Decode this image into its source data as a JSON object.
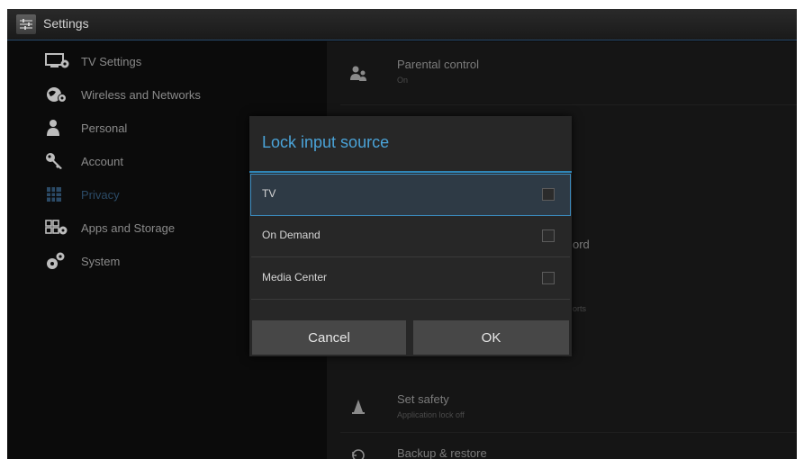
{
  "window": {
    "title": "Settings"
  },
  "sidebar": {
    "items": [
      {
        "label": "TV Settings",
        "icon": "tv-settings-icon",
        "active": false
      },
      {
        "label": "Wireless and Networks",
        "icon": "globe-network-icon",
        "active": false
      },
      {
        "label": "Personal",
        "icon": "person-icon",
        "active": false
      },
      {
        "label": "Account",
        "icon": "key-icon",
        "active": false
      },
      {
        "label": "Privacy",
        "icon": "privacy-grid-icon",
        "active": true
      },
      {
        "label": "Apps and Storage",
        "icon": "apps-storage-icon",
        "active": false
      },
      {
        "label": "System",
        "icon": "gears-icon",
        "active": false
      }
    ]
  },
  "right_panel": {
    "parental_control": {
      "title": "Parental control",
      "subtitle": "On",
      "icon": "parental-control-icon"
    },
    "partial_password_text": "ord",
    "partial_ports_text": "orts",
    "set_safety": {
      "title": "Set safety",
      "subtitle": "Application lock off",
      "icon": "cone-icon"
    },
    "backup_restore": {
      "title": "Backup & restore",
      "icon": "backup-icon"
    }
  },
  "dialog": {
    "title": "Lock input source",
    "options": [
      {
        "label": "TV",
        "checked": false,
        "selected": true
      },
      {
        "label": "On Demand",
        "checked": false,
        "selected": false
      },
      {
        "label": "Media Center",
        "checked": false,
        "selected": false
      }
    ],
    "cancel_label": "Cancel",
    "ok_label": "OK"
  },
  "colors": {
    "accent": "#4aa3d8",
    "background": "#0b0b0b",
    "dialog_bg": "#272727",
    "button_bg": "#474747"
  }
}
